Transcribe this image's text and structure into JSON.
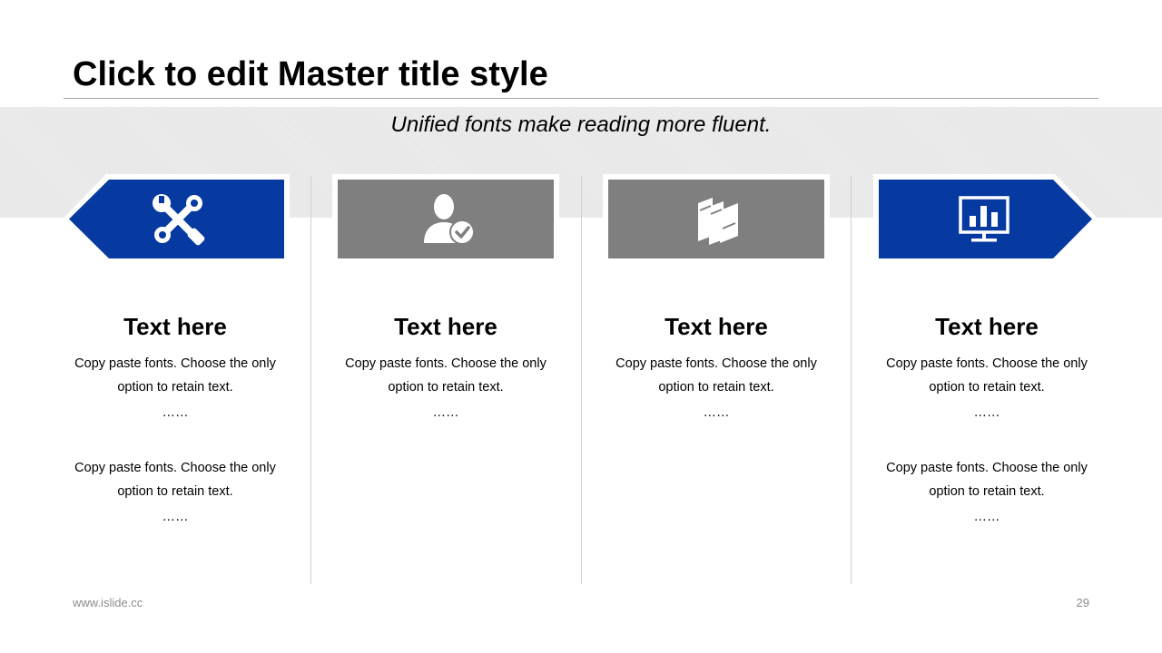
{
  "title": "Click to edit Master title style",
  "subtitle": "Unified fonts make reading more fluent.",
  "colors": {
    "accent_blue": "#063aa0",
    "accent_gray": "#7f7f7f",
    "band": "#ececec"
  },
  "columns": [
    {
      "icon": "tools-icon",
      "color": "#063aa0",
      "heading": "Text here",
      "blocks": [
        {
          "line1": "Copy paste fonts. Choose the only",
          "line2": "option to retain text.",
          "ellipsis": "……"
        },
        {
          "line1": "Copy paste fonts. Choose the only",
          "line2": "option to retain text.",
          "ellipsis": "……"
        }
      ]
    },
    {
      "icon": "user-check-icon",
      "color": "#7f7f7f",
      "heading": "Text here",
      "blocks": [
        {
          "line1": "Copy paste fonts. Choose the only",
          "line2": "option to retain text.",
          "ellipsis": "……"
        }
      ]
    },
    {
      "icon": "books-icon",
      "color": "#7f7f7f",
      "heading": "Text here",
      "blocks": [
        {
          "line1": "Copy paste fonts. Choose the only",
          "line2": "option to retain text.",
          "ellipsis": "……"
        }
      ]
    },
    {
      "icon": "presentation-chart-icon",
      "color": "#063aa0",
      "heading": "Text here",
      "blocks": [
        {
          "line1": "Copy paste fonts. Choose the only",
          "line2": "option to retain text.",
          "ellipsis": "……"
        },
        {
          "line1": "Copy paste fonts. Choose the only",
          "line2": "option to retain text.",
          "ellipsis": "……"
        }
      ]
    }
  ],
  "footer": {
    "url": "www.islide.cc",
    "page_number": "29"
  }
}
